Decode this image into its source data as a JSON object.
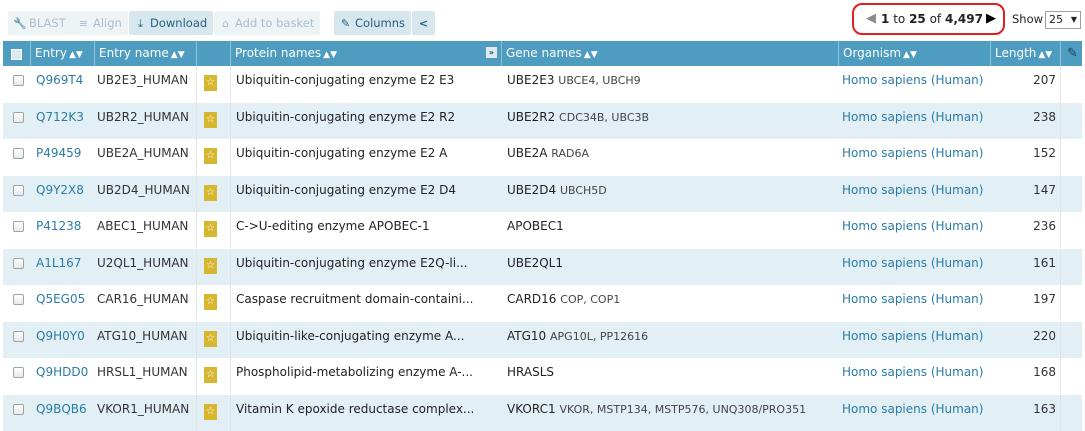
{
  "toolbar": {
    "blast": "BLAST",
    "align": "Align",
    "download": "Download",
    "basket": "Add to basket",
    "columns": "Columns"
  },
  "pager": {
    "start": "1",
    "to": "to",
    "end": "25",
    "of": "of",
    "total": "4,497"
  },
  "show": {
    "label": "Show",
    "value": "25"
  },
  "columns": {
    "entry": "Entry",
    "entry_name": "Entry name",
    "protein_names": "Protein names",
    "gene_names": "Gene names",
    "organism": "Organism",
    "length": "Length"
  },
  "rows": [
    {
      "entry": "Q969T4",
      "entry_name": "UB2E3_HUMAN",
      "protein": "Ubiquitin-conjugating enzyme E2 E3",
      "gene": "UBE2E3",
      "gene_syn": "UBCE4, UBCH9",
      "organism": "Homo sapiens (Human)",
      "length": "207"
    },
    {
      "entry": "Q712K3",
      "entry_name": "UB2R2_HUMAN",
      "protein": "Ubiquitin-conjugating enzyme E2 R2",
      "gene": "UBE2R2",
      "gene_syn": "CDC34B, UBC3B",
      "organism": "Homo sapiens (Human)",
      "length": "238"
    },
    {
      "entry": "P49459",
      "entry_name": "UBE2A_HUMAN",
      "protein": "Ubiquitin-conjugating enzyme E2 A",
      "gene": "UBE2A",
      "gene_syn": "RAD6A",
      "organism": "Homo sapiens (Human)",
      "length": "152"
    },
    {
      "entry": "Q9Y2X8",
      "entry_name": "UB2D4_HUMAN",
      "protein": "Ubiquitin-conjugating enzyme E2 D4",
      "gene": "UBE2D4",
      "gene_syn": "UBCH5D",
      "organism": "Homo sapiens (Human)",
      "length": "147"
    },
    {
      "entry": "P41238",
      "entry_name": "ABEC1_HUMAN",
      "protein": "C->U-editing enzyme APOBEC-1",
      "gene": "APOBEC1",
      "gene_syn": "",
      "organism": "Homo sapiens (Human)",
      "length": "236"
    },
    {
      "entry": "A1L167",
      "entry_name": "U2QL1_HUMAN",
      "protein": "Ubiquitin-conjugating enzyme E2Q-li...",
      "gene": "UBE2QL1",
      "gene_syn": "",
      "organism": "Homo sapiens (Human)",
      "length": "161"
    },
    {
      "entry": "Q5EG05",
      "entry_name": "CAR16_HUMAN",
      "protein": "Caspase recruitment domain-containi...",
      "gene": "CARD16",
      "gene_syn": "COP, COP1",
      "organism": "Homo sapiens (Human)",
      "length": "197"
    },
    {
      "entry": "Q9H0Y0",
      "entry_name": "ATG10_HUMAN",
      "protein": "Ubiquitin-like-conjugating enzyme A...",
      "gene": "ATG10",
      "gene_syn": "APG10L, PP12616",
      "organism": "Homo sapiens (Human)",
      "length": "220"
    },
    {
      "entry": "Q9HDD0",
      "entry_name": "HRSL1_HUMAN",
      "protein": "Phospholipid-metabolizing enzyme A-...",
      "gene": "HRASLS",
      "gene_syn": "",
      "organism": "Homo sapiens (Human)",
      "length": "168"
    },
    {
      "entry": "Q9BQB6",
      "entry_name": "VKOR1_HUMAN",
      "protein": "Vitamin K epoxide reductase complex...",
      "gene": "VKORC1",
      "gene_syn": "VKOR, MSTP134, MSTP576, UNQ308/PRO351",
      "organism": "Homo sapiens (Human)",
      "length": "163"
    }
  ],
  "icons": {
    "blast": "wrench-icon",
    "align": "align-lines-icon",
    "download": "download-icon",
    "basket": "basket-icon",
    "columns": "pencil-icon",
    "share": "share-icon",
    "reviewed": "reviewed-star-icon"
  },
  "colors": {
    "header": "#4e9dc0",
    "row_alt": "#e2eff5",
    "link": "#2a7ca6",
    "pager_highlight": "#e02020",
    "reviewed": "#d8b730"
  }
}
